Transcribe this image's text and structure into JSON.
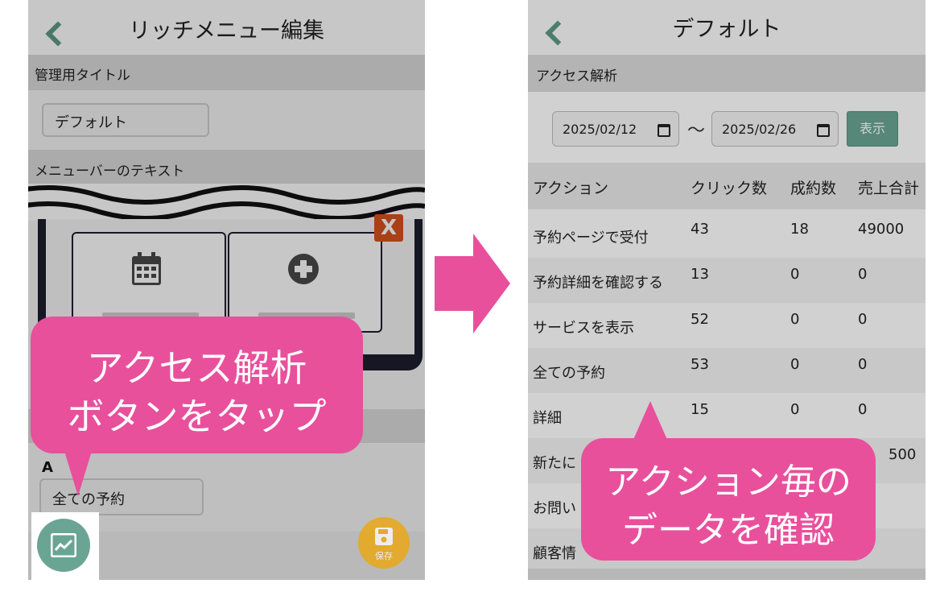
{
  "left_screen": {
    "header_title": "リッチメニュー編集",
    "section_title_label": "管理用タイトル",
    "title_input_value": "デフォルト",
    "section_menubar_label": "メニューバーのテキスト",
    "delete_label": "X",
    "section_a_label": "A",
    "action_select_value": "全ての予約",
    "save_label": "保存"
  },
  "right_screen": {
    "header_title": "デフォルト",
    "section_label": "アクセス解析",
    "date_from": "2025/02/12",
    "date_separator": "〜",
    "date_to": "2025/02/26",
    "show_button": "表示",
    "table": {
      "headers": [
        "アクション",
        "クリック数",
        "成約数",
        "売上合計"
      ],
      "rows": [
        [
          "予約ページで受付",
          "43",
          "18",
          "49000"
        ],
        [
          "予約詳細を確認する",
          "13",
          "0",
          "0"
        ],
        [
          "サービスを表示",
          "52",
          "0",
          "0"
        ],
        [
          "全ての予約",
          "53",
          "0",
          "0"
        ],
        [
          "詳細",
          "15",
          "0",
          "0"
        ],
        [
          "新たに",
          "",
          "",
          "500"
        ],
        [
          "お問い",
          "",
          "",
          ""
        ],
        [
          "顧客情",
          "",
          "",
          ""
        ]
      ]
    }
  },
  "callouts": {
    "left_line1": "アクセス解析",
    "left_line2": "ボタンをタップ",
    "right_line1": "アクション毎の",
    "right_line2": "データを確認"
  },
  "colors": {
    "accent_pink": "#e8509c",
    "teal": "#6aa594",
    "save_orange": "#f0a500"
  }
}
